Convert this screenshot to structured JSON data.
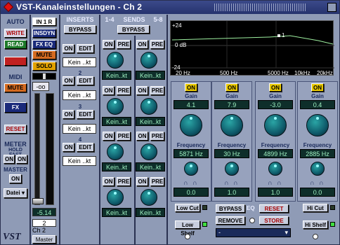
{
  "window": {
    "title": "VST-Kanaleinstellungen - Ch 2"
  },
  "left": {
    "auto": "AUTO",
    "write": "WRITE",
    "read": "READ",
    "off": "OFF",
    "midi": "MIDI",
    "mute": "MUTE",
    "fx": "FX",
    "reset": "RESET",
    "meter": "METER",
    "holdfast": "HOLD FAST",
    "on1": "ON",
    "on2": "ON",
    "master": "MASTER",
    "master_on": "ON",
    "datei": "Datei"
  },
  "strip": {
    "input": "IN 1 R",
    "insdyn": "INSDYN",
    "fxeq": "FX EQ",
    "mute": "MUTE",
    "solo": "SOLO",
    "volume": "-oo",
    "level": "-5.14",
    "channel_num": "2",
    "channel_name": "Ch 2",
    "output": "Master"
  },
  "inserts": {
    "header": "INSERTS",
    "bypass": "BYPASS",
    "slots": [
      {
        "num": "",
        "on": "ON",
        "edit": "EDIT",
        "name": "Kein ..kt"
      },
      {
        "num": "2",
        "on": "ON",
        "edit": "EDIT",
        "name": "Kein ..kt"
      },
      {
        "num": "3",
        "on": "ON",
        "edit": "EDIT",
        "name": "Kein ..kt"
      },
      {
        "num": "4",
        "on": "ON",
        "edit": "EDIT",
        "name": "Kein ..kt"
      }
    ]
  },
  "sends": {
    "header_a": "1-4",
    "header_b": "SENDS",
    "header_c": "5-8",
    "bypass": "BYPASS",
    "on": "ON",
    "pre": "PRE",
    "name": "Kein..kt"
  },
  "eqgraph": {
    "y_top": "+24",
    "y_mid": "0 dB",
    "y_bot": "-24",
    "x_labels": [
      "20 Hz",
      "500 Hz",
      "5000 Hz",
      "10kHz",
      "20kHz"
    ],
    "marker": "1"
  },
  "bands": [
    {
      "on": "ON",
      "gain_label": "Gain",
      "gain": "4.1",
      "freq_label": "Frequency",
      "freq": "5871 Hz",
      "q": "0.0",
      "filter": "Low Cut",
      "shelf": "Low Shelf"
    },
    {
      "on": "ON",
      "gain_label": "Gain",
      "gain": "7.9",
      "freq_label": "Frequency",
      "freq": "30 Hz",
      "q": "1.0"
    },
    {
      "on": "ON",
      "gain_label": "Gain",
      "gain": "-3.0",
      "freq_label": "Frequency",
      "freq": "4899 Hz",
      "q": "1.0"
    },
    {
      "on": "ON",
      "gain_label": "Gain",
      "gain": "0.4",
      "freq_label": "Frequency",
      "freq": "2885 Hz",
      "q": "0.0",
      "filter": "Hi Cut",
      "shelf": "Hi Shelf"
    }
  ],
  "eqcontrols": {
    "bypass": "BYPASS",
    "eq": "EQ",
    "reset": "RESET",
    "remove": "REMOVE",
    "store": "STORE",
    "preset": "-"
  },
  "logo": "VST"
}
